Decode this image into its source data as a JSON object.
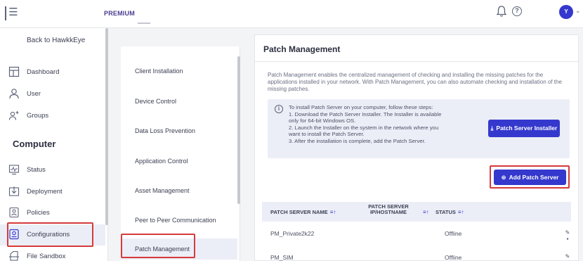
{
  "topbar": {
    "menu_icon": "menu-collapse-icon",
    "plan_label": "PREMIUM",
    "notifications_icon": "bell-icon",
    "help_label": "?",
    "avatar_initial": "Y",
    "avatar_caret": "⌄"
  },
  "sidebar": {
    "back_label": "Back to HawkkEye",
    "items_top": [
      {
        "label": "Dashboard",
        "icon": "dashboard-icon"
      },
      {
        "label": "User",
        "icon": "user-icon"
      },
      {
        "label": "Groups",
        "icon": "groups-icon"
      }
    ],
    "section_title": "Computer",
    "items_computer": [
      {
        "label": "Status",
        "icon": "status-icon"
      },
      {
        "label": "Deployment",
        "icon": "deployment-icon"
      },
      {
        "label": "Policies",
        "icon": "policies-icon"
      },
      {
        "label": "Configurations",
        "icon": "configurations-icon",
        "active": true
      },
      {
        "label": "File Sandbox",
        "icon": "file-sandbox-icon"
      }
    ]
  },
  "subnav": {
    "items": [
      {
        "label": "Client Installation"
      },
      {
        "label": "Device Control"
      },
      {
        "label": "Data Loss Prevention"
      },
      {
        "label": "Application Control"
      },
      {
        "label": "Asset Management"
      },
      {
        "label": "Peer to Peer Communication"
      },
      {
        "label": "Patch Management",
        "active": true
      }
    ]
  },
  "main": {
    "title": "Patch Management",
    "description": "Patch Management enables the centralized management of checking and installing the missing patches for the applications installed in your network. With Patch Management, you can also automate checking and installation of the missing patches.",
    "info": {
      "line1": "To install Patch Server on your computer, follow these steps:",
      "line2": "1. Download the Patch Server Installer. The Installer is available only for 64-bit Windows OS.",
      "line3": "2. Launch the Installer on the system in the network where you want to install the Patch Server.",
      "line4": "3. After the installation is complete, add the Patch Server."
    },
    "installer_button": "Patch Server Installer",
    "add_button": "Add Patch Server",
    "table": {
      "columns": [
        "PATCH SERVER NAME",
        "PATCH SERVER IP/HOSTNAME",
        "STATUS"
      ],
      "rows": [
        {
          "name": "PM_Private2k22",
          "ip": "",
          "status": "Offline"
        },
        {
          "name": "PM_SIM",
          "ip": "",
          "status": "Offline"
        }
      ]
    }
  },
  "colors": {
    "accent": "#3538cd",
    "highlight": "#d63a3a",
    "active_bg": "#eceef7"
  }
}
